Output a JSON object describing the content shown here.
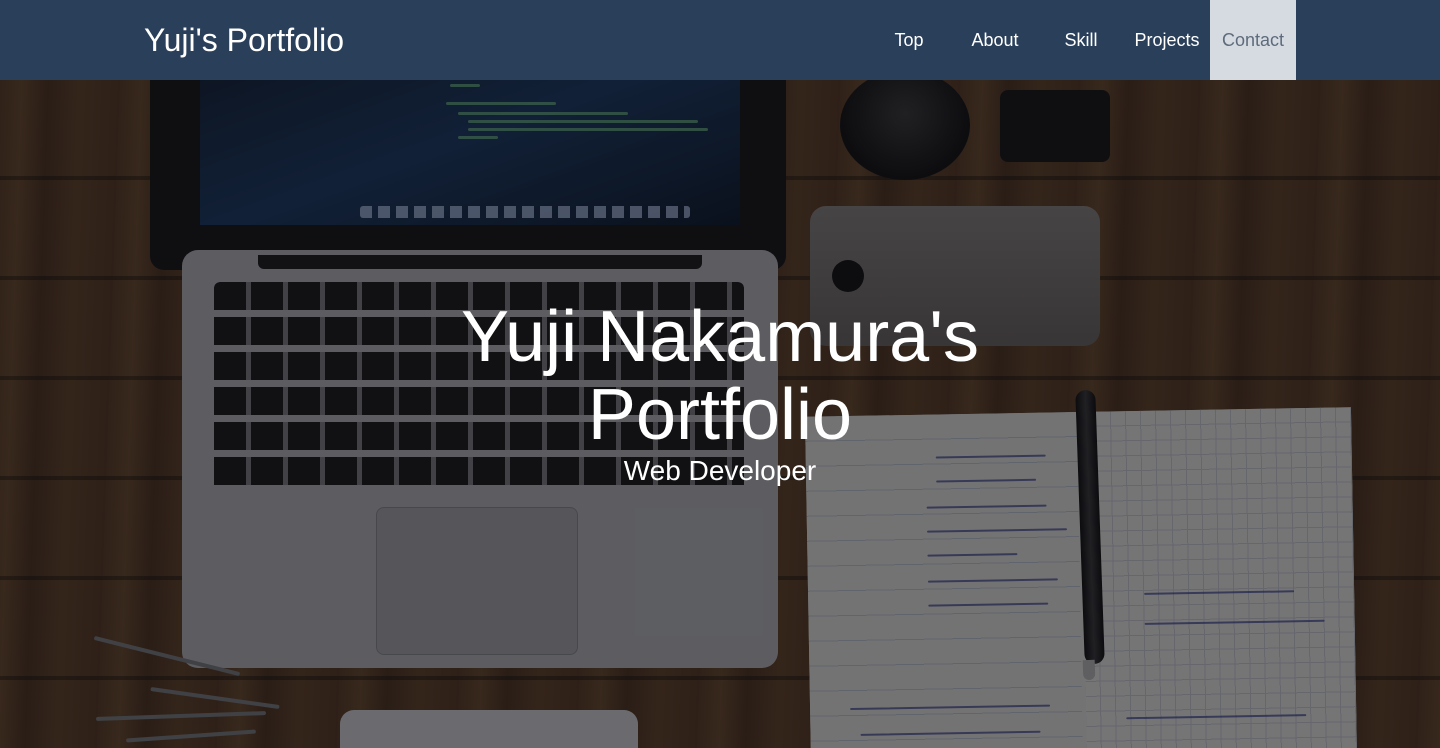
{
  "brand": "Yuji's Portfolio",
  "nav": {
    "items": [
      "Top",
      "About",
      "Skill",
      "Projects",
      "Contact"
    ],
    "active": "Contact"
  },
  "hero": {
    "title": "Yuji Nakamura's Portfolio",
    "subtitle": "Web Developer"
  },
  "colors": {
    "navbar": "#2a3f5a",
    "nav_active_bg": "#d6dbe2",
    "nav_active_text": "#5e6b7b",
    "hero_text": "#ffffff"
  }
}
